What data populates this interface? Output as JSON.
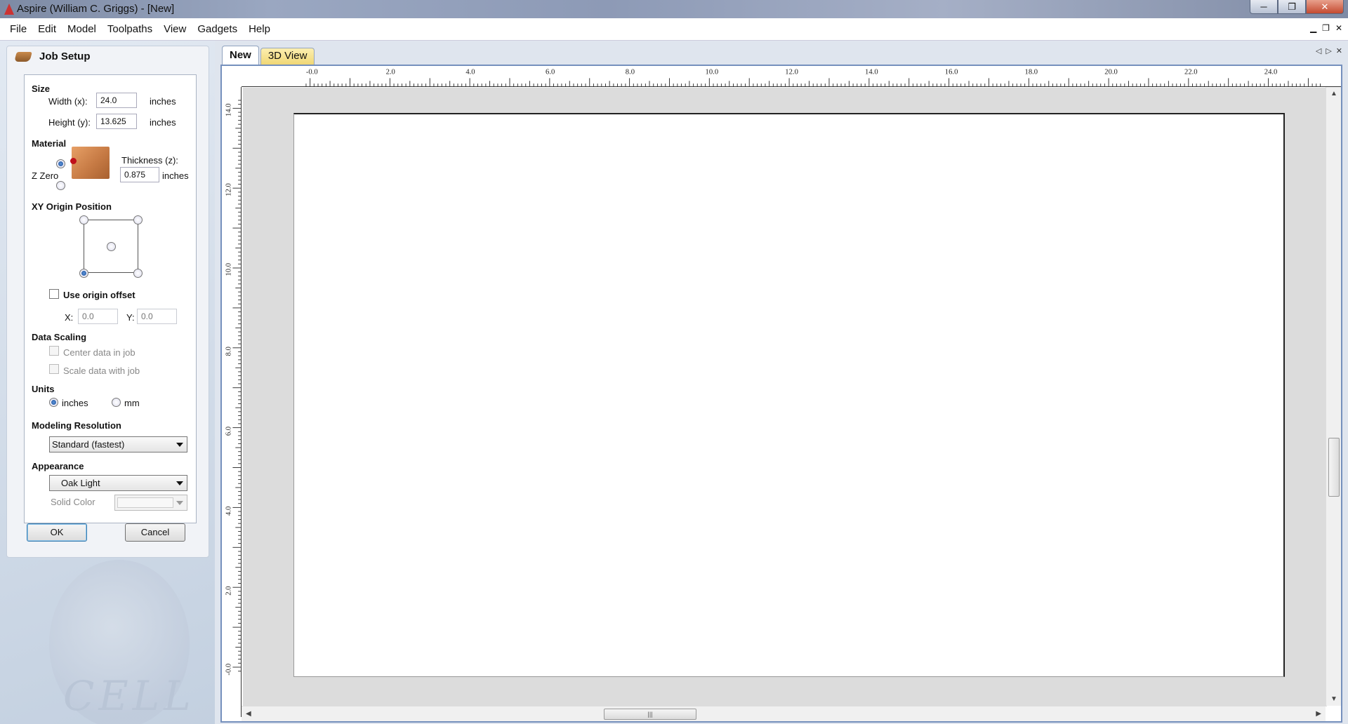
{
  "window": {
    "title": "Aspire (William C. Griggs) - [New]",
    "min": "─",
    "max": "❐",
    "close": "✕"
  },
  "menu": [
    "File",
    "Edit",
    "Model",
    "Toolpaths",
    "View",
    "Gadgets",
    "Help"
  ],
  "mdi": {
    "min": "▁",
    "restore": "❐",
    "close": "✕"
  },
  "panel": {
    "title": "Job Setup",
    "size": {
      "section": "Size",
      "width_label": "Width (x):",
      "width_value": "24.0",
      "height_label": "Height (y):",
      "height_value": "13.625",
      "unit": "inches"
    },
    "material": {
      "section": "Material",
      "zzero_label": "Z Zero",
      "thickness_label": "Thickness (z):",
      "thickness_value": "0.875",
      "unit": "inches"
    },
    "xy_origin": {
      "section": "XY Origin Position",
      "offset_label": "Use origin offset",
      "x_label": "X:",
      "x_placeholder": "0.0",
      "y_label": "Y:",
      "y_placeholder": "0.0"
    },
    "scaling": {
      "section": "Data Scaling",
      "center_label": "Center data in job",
      "scale_label": "Scale data with job"
    },
    "units": {
      "section": "Units",
      "inches_label": "inches",
      "mm_label": "mm"
    },
    "resolution": {
      "section": "Modeling Resolution",
      "value": "Standard (fastest)"
    },
    "appearance": {
      "section": "Appearance",
      "value": "Oak Light",
      "solid_color_label": "Solid Color"
    },
    "ok_label": "OK",
    "cancel_label": "Cancel"
  },
  "tabs": [
    {
      "label": "New",
      "active": true
    },
    {
      "label": "3D View",
      "active": false
    }
  ],
  "tabnav": {
    "prev": "◁",
    "next": "▷",
    "close": "✕"
  },
  "ruler": {
    "horizontal_labels": [
      "-0.0",
      "2.0",
      "4.0",
      "6.0",
      "8.0",
      "10.0",
      "12.0",
      "14.0",
      "16.0",
      "18.0",
      "20.0",
      "22.0",
      "24.0"
    ],
    "vertical_labels": [
      "14.0",
      "12.0",
      "10.0",
      "8.0",
      "6.0",
      "4.0",
      "2.0",
      "-0.0"
    ]
  },
  "scroll": {
    "up": "▲",
    "down": "▼",
    "left": "◀",
    "right": "▶",
    "grip": "|||"
  },
  "colors": {
    "accent": "#7590bd",
    "tab_inactive": "#f0d775",
    "material": "#c77b45"
  }
}
